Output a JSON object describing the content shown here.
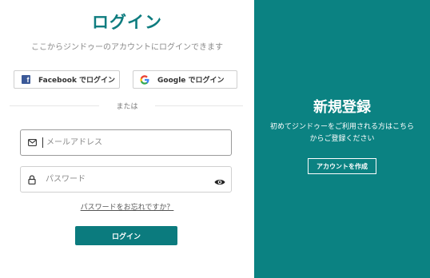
{
  "login": {
    "title": "ログイン",
    "subtitle": "ここからジンドゥーのアカウントにログインできます",
    "facebook_label": "Facebook でログイン",
    "google_label": "Google でログイン",
    "or_text": "または",
    "email_placeholder": "メールアドレス",
    "password_placeholder": "パスワード",
    "forgot_link": "パスワードをお忘れですか？",
    "login_button": "ログイン",
    "accent_color": "#0e7c7f"
  },
  "signup": {
    "title": "新規登録",
    "text": "初めてジンドゥーをご利用される方はこちらからご登録ください",
    "button": "アカウントを作成",
    "background_color": "#0b8282"
  },
  "icons": {
    "facebook": "facebook-icon",
    "google": "google-icon",
    "email": "envelope-icon",
    "password": "lock-icon",
    "toggle": "eye-icon"
  }
}
